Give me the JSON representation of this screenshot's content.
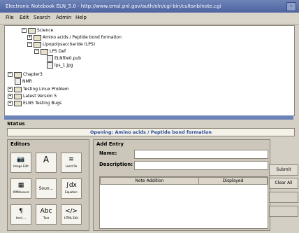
{
  "window": {
    "title": "Electronic Notebook ELN_5.0 - http://www.emsl.pnl.gov/auth/eln/cgi-bin/cultsnb/note.cgi",
    "min_glyph": "-"
  },
  "menu": [
    "File",
    "Edit",
    "Search",
    "Admin",
    "Help"
  ],
  "tree": [
    {
      "label": "Science",
      "kind": "folder"
    },
    {
      "label": "Amino acids / Peptide bond formation",
      "kind": "folder"
    },
    {
      "label": "Lipopolysaccharide (LPS)",
      "kind": "folder"
    },
    {
      "label": "LPS Def",
      "kind": "folder"
    },
    {
      "label": "ELNfile0.pub",
      "kind": "file"
    },
    {
      "label": "lps_1.jpg",
      "kind": "file"
    },
    {
      "label": "Chapter3",
      "kind": "folder"
    },
    {
      "label": "NMR",
      "kind": "file"
    },
    {
      "label": "Testing Linux Problem",
      "kind": "folder"
    },
    {
      "label": "Latest Version 5",
      "kind": "folder"
    },
    {
      "label": "ELN5 Testing Bugs",
      "kind": "folder"
    }
  ],
  "status": {
    "label": "Status",
    "text": "Opening: Amino acids / Peptide bond formation"
  },
  "editors": {
    "label": "Editors",
    "items": [
      {
        "icon": "camera-icon",
        "glyph": "📷",
        "caption": "Image Edit"
      },
      {
        "icon": "text-icon",
        "glyph": "A",
        "caption": ""
      },
      {
        "icon": "list-icon",
        "glyph": "≡",
        "caption": "Lasst Re"
      },
      {
        "icon": "chart-icon",
        "glyph": "▦",
        "caption": "XMMeasure"
      },
      {
        "icon": "sound-icon",
        "glyph": "Soun...",
        "caption": ""
      },
      {
        "icon": "equation-icon",
        "glyph": "∫dx",
        "caption": "Equation"
      },
      {
        "icon": "note-icon",
        "glyph": "¶",
        "caption": "html ..."
      },
      {
        "icon": "rich-text-icon",
        "glyph": "Abc",
        "caption": "Text"
      },
      {
        "icon": "html-icon",
        "glyph": "</>",
        "caption": "HTML Edit"
      }
    ]
  },
  "add_entry": {
    "label": "Add Entry",
    "name_label": "Name:",
    "name_value": "",
    "description_label": "Description:",
    "description_value": "",
    "columns": [
      "Note Addition",
      "Displayed"
    ]
  },
  "buttons": {
    "submit": "Submit",
    "clear_all": "Clear All",
    "disabled1": "",
    "disabled2": ""
  }
}
